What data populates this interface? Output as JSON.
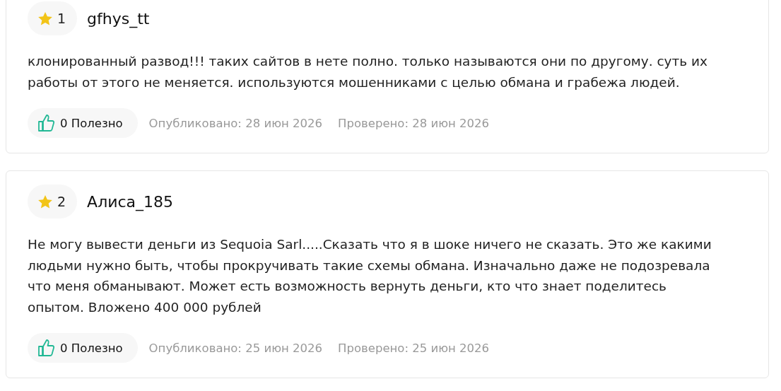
{
  "reviews": [
    {
      "rating": "1",
      "author": "gfhys_tt",
      "text": "клонированный развод!!! таких сайтов в нете полно. только называются они по другому. суть их работы от этого не меняется. используются мошенниками с целью обмана и грабежа людей.",
      "likes": "0 Полезно",
      "published": "Опубликовано: 28 июн 2026",
      "checked": "Проверено: 28 июн 2026"
    },
    {
      "rating": "2",
      "author": "Алиса_185",
      "text": "Не могу вывести деньги из Sequoia Sarl.....Сказать что я в шоке ничего не сказать. Это же какими людьми нужно быть, чтобы прокручивать такие схемы обмана. Изначально даже не подозревала что меня обманывают. Может есть возможность вернуть деньги, кто что знает поделитесь опытом. Вложено 400 000 рублей",
      "likes": "0 Полезно",
      "published": "Опубликовано: 25 июн 2026",
      "checked": "Проверено: 25 июн 2026"
    }
  ]
}
